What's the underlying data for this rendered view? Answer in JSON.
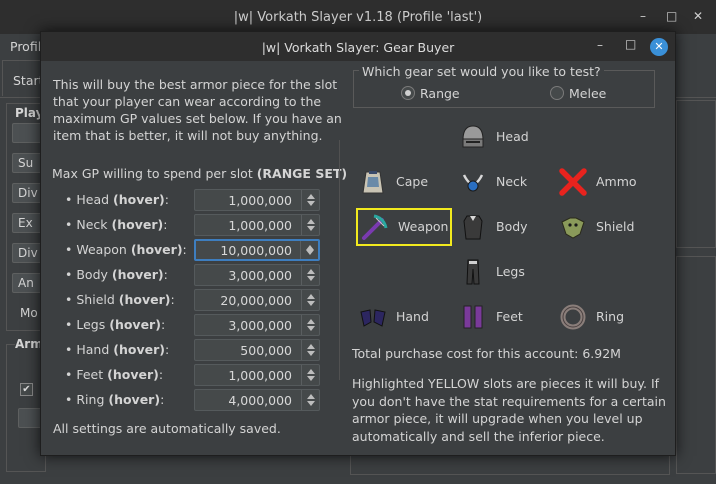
{
  "main_window": {
    "title": "|w| Vorkath Slayer v1.18 (Profile 'last')",
    "menu_profile": "Profile",
    "tab_start": "Start",
    "left_panel_title": "Play",
    "left_buttons": [
      "",
      "Su",
      "Div",
      "Ex",
      "Div",
      "An"
    ],
    "left_misc_label": "Mo",
    "left_panel2_title": "Arm",
    "checkbox_checked": "✔",
    "controls": {
      "minimize": "–",
      "maximize": "□",
      "close": "✕"
    }
  },
  "dialog": {
    "title": "|w| Vorkath Slayer: Gear Buyer",
    "controls": {
      "minimize": "–",
      "maximize": "□",
      "close": "✕"
    },
    "description": "This will buy the best armor piece for the slot that your player can wear according to the maximum GP values set below. If you have an item that is better, it will not buy anything.",
    "max_gp_prefix": "Max GP willing to spend per slot ",
    "max_gp_set": "(RANGE SET)",
    "hover_suffix": "(hover)",
    "slots": [
      {
        "name": "Head",
        "value": "1,000,000"
      },
      {
        "name": "Neck",
        "value": "1,000,000"
      },
      {
        "name": "Weapon",
        "value": "10,000,000",
        "focused": true
      },
      {
        "name": "Body",
        "value": "3,000,000"
      },
      {
        "name": "Shield",
        "value": "20,000,000"
      },
      {
        "name": "Legs",
        "value": "3,000,000"
      },
      {
        "name": "Hand",
        "value": "500,000"
      },
      {
        "name": "Feet",
        "value": "1,000,000"
      },
      {
        "name": "Ring",
        "value": "4,000,000"
      }
    ],
    "autosave_note": "All settings are automatically saved.",
    "gear_set_question": "Which gear set would you like to test?",
    "gear_set_options": [
      {
        "label": "Range",
        "selected": true
      },
      {
        "label": "Melee",
        "selected": false
      }
    ],
    "equipment_slots": {
      "head": "Head",
      "cape": "Cape",
      "neck": "Neck",
      "ammo": "Ammo",
      "weapon": "Weapon",
      "body": "Body",
      "shield": "Shield",
      "legs": "Legs",
      "hand": "Hand",
      "feet": "Feet",
      "ring": "Ring"
    },
    "highlighted_slot": "Weapon",
    "highlight_color": "#f2ea1e",
    "total_cost": "Total purchase cost for this account: 6.92M",
    "footer_note": "Highlighted YELLOW slots are pieces it will buy. If you don't have the stat requirements for a certain armor piece, it will upgrade when you level up automatically and sell the inferior piece."
  }
}
